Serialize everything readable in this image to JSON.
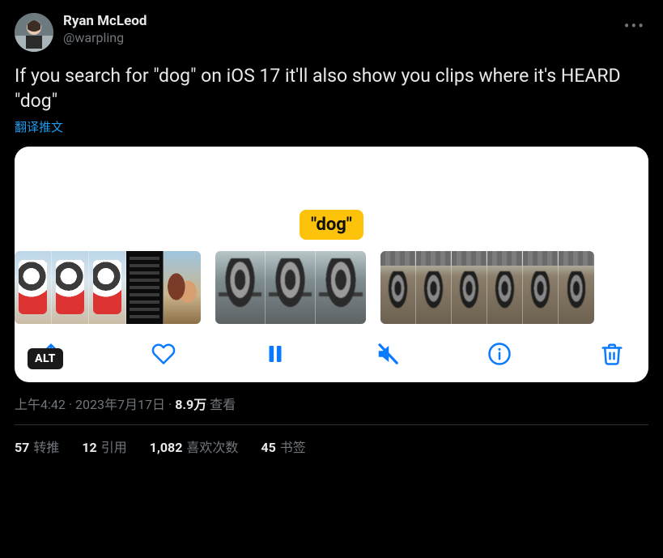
{
  "user": {
    "display_name": "Ryan McLeod",
    "handle": "@warpling"
  },
  "tweet_text": "If you search for \"dog\" on iOS 17 it'll also show you clips where it's HEARD \"dog\"",
  "translate_label": "翻译推文",
  "media": {
    "search_term": "\"dog\"",
    "alt_badge": "ALT"
  },
  "meta": {
    "time": "上午4:42",
    "date": "2023年7月17日",
    "views_num": "8.9万",
    "views_label": "查看"
  },
  "stats": {
    "retweets_num": "57",
    "retweets_label": "转推",
    "quotes_num": "12",
    "quotes_label": "引用",
    "likes_num": "1,082",
    "likes_label": "喜欢次数",
    "bookmarks_num": "45",
    "bookmarks_label": "书签"
  }
}
